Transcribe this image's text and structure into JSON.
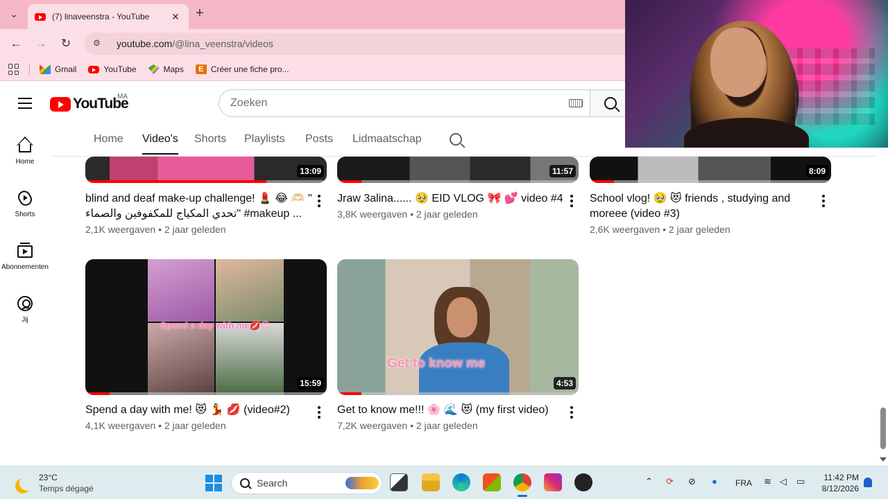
{
  "browser": {
    "tab_title": "(7) linaveenstra - YouTube",
    "url_host": "youtube.com",
    "url_path": "/@lina_veenstra/videos",
    "bookmarks": [
      {
        "label": "Gmail",
        "icon": "gmail-icon"
      },
      {
        "label": "YouTube",
        "icon": "youtube-icon"
      },
      {
        "label": "Maps",
        "icon": "maps-icon"
      },
      {
        "label": "Créer une fiche pro...",
        "icon": "e-icon"
      }
    ]
  },
  "youtube": {
    "logo_text": "YouTube",
    "country_code": "MA",
    "search_placeholder": "Zoeken",
    "guide": [
      {
        "label": "Home",
        "icon": "home-icon"
      },
      {
        "label": "Shorts",
        "icon": "shorts-icon"
      },
      {
        "label": "Abonnementen",
        "icon": "subscriptions-icon"
      },
      {
        "label": "Jij",
        "icon": "you-icon"
      }
    ],
    "channel_tabs": [
      "Home",
      "Video's",
      "Shorts",
      "Playlists",
      "Posts",
      "Lidmaatschap"
    ],
    "active_tab": "Video's",
    "videos_top": [
      {
        "duration": "13:09",
        "title": "blind and deaf make-up challenge! 💄 😂 🫶🏻 \" تحدي المكياج للمكفوفين والصماء\" #makeup ...",
        "views": "2,1K weergaven",
        "age": "2 jaar geleden",
        "watched": 0.75
      },
      {
        "duration": "11:57",
        "title": "Jraw 3alina...... 🥹 EID VLOG 🎀 💕 video #4",
        "views": "3,8K weergaven",
        "age": "2 jaar geleden",
        "watched": 0.1
      },
      {
        "duration": "8:09",
        "title": "School vlog! 🥹 😻 friends , studying and moreee (video #3)",
        "views": "2,6K weergaven",
        "age": "2 jaar geleden",
        "watched": 0.1
      }
    ],
    "videos_bottom": [
      {
        "duration": "15:59",
        "title": "Spend a day with me! 😻 💃 💋 (video#2)",
        "views": "4,1K weergaven",
        "age": "2 jaar geleden",
        "watched": 0.1,
        "overlay": "Spend a day with me💋😌"
      },
      {
        "duration": "4:53",
        "title": "Get to know me!!! 🌸 🌊 😻 (my first video)",
        "views": "7,2K weergaven",
        "age": "2 jaar geleden",
        "watched": 0.1,
        "overlay": "Get to know me"
      }
    ]
  },
  "taskbar": {
    "temperature": "23°C",
    "weather": "Temps dégagé",
    "search_placeholder": "Search",
    "language": "FRA",
    "time": "11:42 PM",
    "date": "8/12/2026"
  },
  "colors": {
    "chrome_frame": "#f5b8c6",
    "chrome_toolbar": "#fcdfe6",
    "youtube_red": "#ff0000",
    "taskbar": "#dfecef"
  }
}
